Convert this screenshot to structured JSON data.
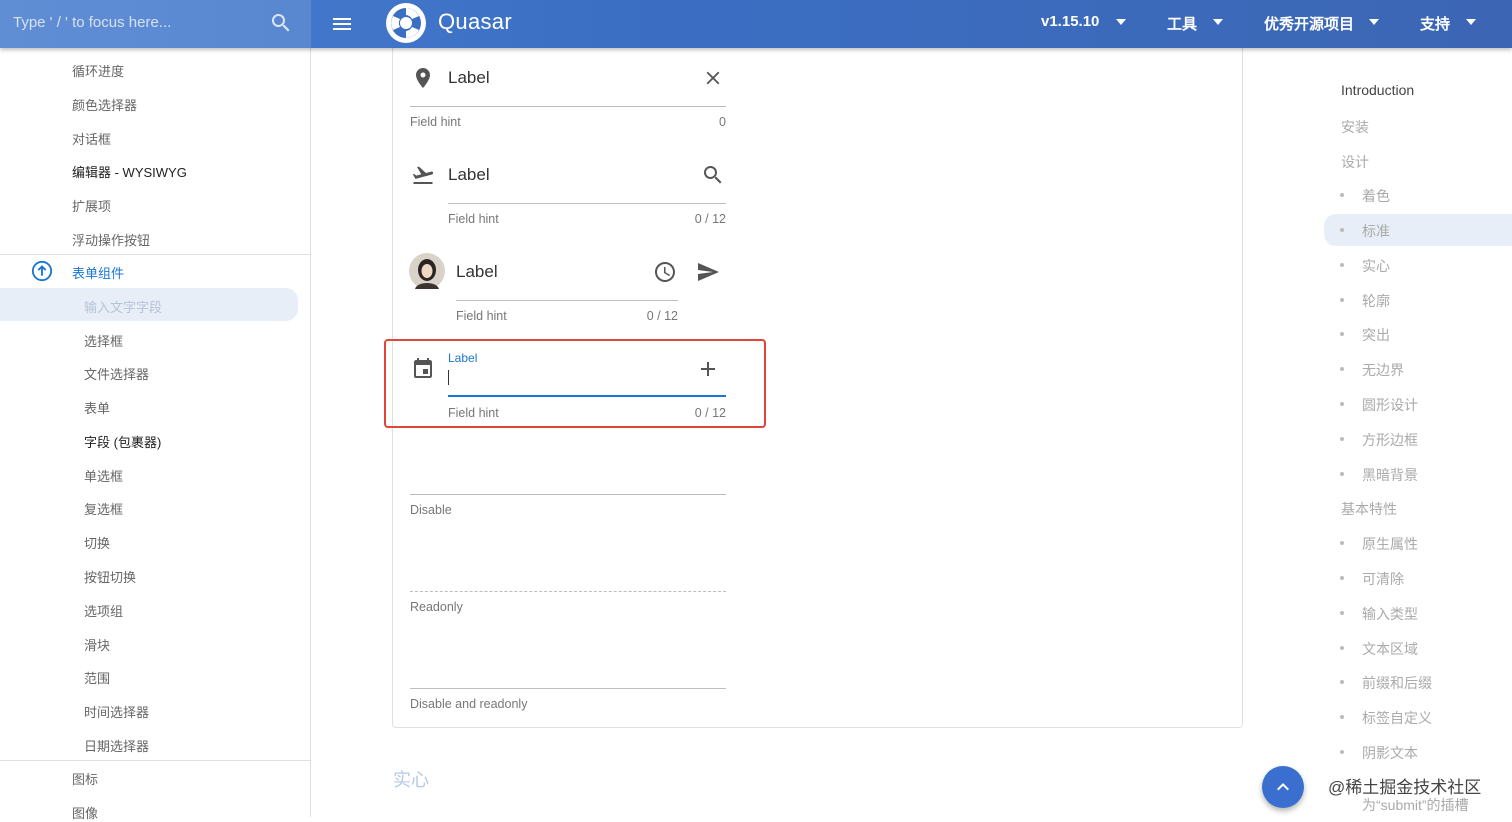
{
  "header": {
    "search_placeholder": "Type ' / ' to focus here...",
    "brand": "Quasar",
    "version": "v1.15.10",
    "nav": [
      "工具",
      "优秀开源项目",
      "支持"
    ]
  },
  "sidebar": {
    "items_top": [
      "循环进度",
      "颜色选择器",
      "对话框",
      "编辑器 - WYSIWYG",
      "扩展项",
      "浮动操作按钮"
    ],
    "group_label": "表单组件",
    "sub_items": [
      "输入文字字段",
      "选择框",
      "文件选择器",
      "表单",
      "字段 (包裹器)",
      "单选框",
      "复选框",
      "切换",
      "按钮切换",
      "选项组",
      "滑块",
      "范围",
      "时间选择器",
      "日期选择器"
    ],
    "items_bottom": [
      "图标",
      "图像"
    ]
  },
  "fields": [
    {
      "label": "Label",
      "hint": "Field hint",
      "count": "0"
    },
    {
      "label": "Label",
      "hint": "Field hint",
      "count": "0 / 12"
    },
    {
      "label": "Label",
      "hint": "Field hint",
      "count": "0 / 12"
    },
    {
      "label": "Label",
      "hint": "Field hint",
      "count": "0 / 12"
    },
    {
      "hint": "Disable"
    },
    {
      "hint": "Readonly"
    },
    {
      "hint": "Disable and readonly"
    }
  ],
  "section_title": "实心",
  "toc": {
    "intro": "Introduction",
    "items": [
      {
        "label": "安装",
        "sub": false
      },
      {
        "label": "设计",
        "sub": false
      },
      {
        "label": "着色",
        "sub": true
      },
      {
        "label": "标准",
        "sub": true
      },
      {
        "label": "实心",
        "sub": true
      },
      {
        "label": "轮廓",
        "sub": true
      },
      {
        "label": "突出",
        "sub": true
      },
      {
        "label": "无边界",
        "sub": true
      },
      {
        "label": "圆形设计",
        "sub": true
      },
      {
        "label": "方形边框",
        "sub": true
      },
      {
        "label": "黑暗背景",
        "sub": true
      },
      {
        "label": "基本特性",
        "sub": false
      },
      {
        "label": "原生属性",
        "sub": true
      },
      {
        "label": "可清除",
        "sub": true
      },
      {
        "label": "输入类型",
        "sub": true
      },
      {
        "label": "文本区域",
        "sub": true
      },
      {
        "label": "前缀和后缀",
        "sub": true
      },
      {
        "label": "标签自定义",
        "sub": true
      },
      {
        "label": "阴影文本",
        "sub": true
      },
      {
        "label": "为“submit”的插槽",
        "sub": true
      }
    ]
  },
  "watermark": "@稀土掘金技术社区",
  "colors": {
    "primary": "#1976d2",
    "header": "#3b6fc4",
    "highlight": "#e0453a"
  }
}
